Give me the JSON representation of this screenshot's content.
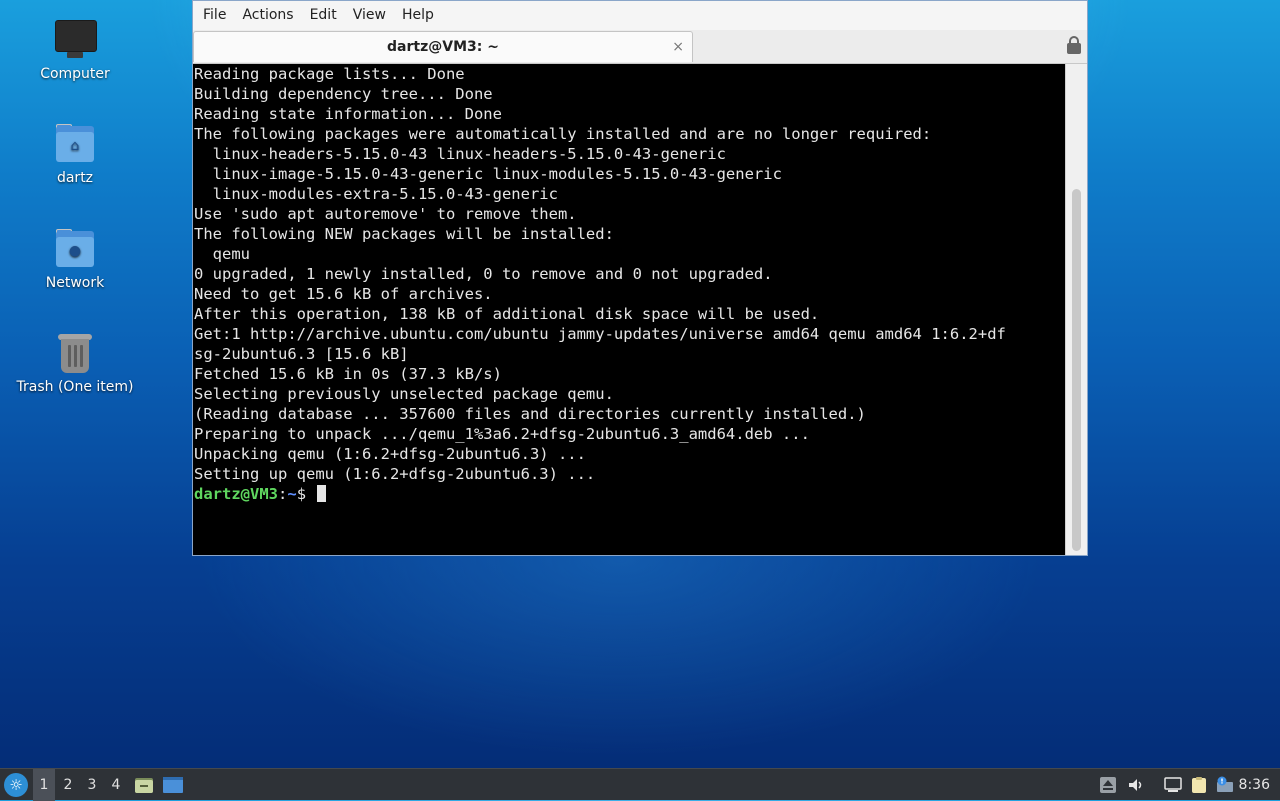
{
  "desktop": {
    "icons": [
      {
        "label": "Computer"
      },
      {
        "label": "dartz"
      },
      {
        "label": "Network"
      },
      {
        "label": "Trash (One item)"
      }
    ]
  },
  "window": {
    "menu": [
      "File",
      "Actions",
      "Edit",
      "View",
      "Help"
    ],
    "tab_title": "dartz@VM3: ~",
    "tab_close": "×"
  },
  "terminal": {
    "lines": [
      "Reading package lists... Done",
      "Building dependency tree... Done",
      "Reading state information... Done",
      "The following packages were automatically installed and are no longer required:",
      "  linux-headers-5.15.0-43 linux-headers-5.15.0-43-generic",
      "  linux-image-5.15.0-43-generic linux-modules-5.15.0-43-generic",
      "  linux-modules-extra-5.15.0-43-generic",
      "Use 'sudo apt autoremove' to remove them.",
      "The following NEW packages will be installed:",
      "  qemu",
      "0 upgraded, 1 newly installed, 0 to remove and 0 not upgraded.",
      "Need to get 15.6 kB of archives.",
      "After this operation, 138 kB of additional disk space will be used.",
      "Get:1 http://archive.ubuntu.com/ubuntu jammy-updates/universe amd64 qemu amd64 1:6.2+df",
      "sg-2ubuntu6.3 [15.6 kB]",
      "Fetched 15.6 kB in 0s (37.3 kB/s)",
      "Selecting previously unselected package qemu.",
      "(Reading database ... 357600 files and directories currently installed.)",
      "Preparing to unpack .../qemu_1%3a6.2+dfsg-2ubuntu6.3_amd64.deb ...",
      "Unpacking qemu (1:6.2+dfsg-2ubuntu6.3) ...",
      "Setting up qemu (1:6.2+dfsg-2ubuntu6.3) ..."
    ],
    "prompt": {
      "user_host": "dartz@VM3",
      "sep": ":",
      "path": "~",
      "symbol": "$ "
    }
  },
  "taskbar": {
    "workspaces": [
      "1",
      "2",
      "3",
      "4"
    ],
    "active_workspace": "1",
    "clock": "8:36"
  },
  "colors": {
    "prompt_user": "#5fd75f",
    "prompt_path": "#5f8fff",
    "terminal_bg": "#000000",
    "terminal_fg": "#e6e6e6"
  }
}
